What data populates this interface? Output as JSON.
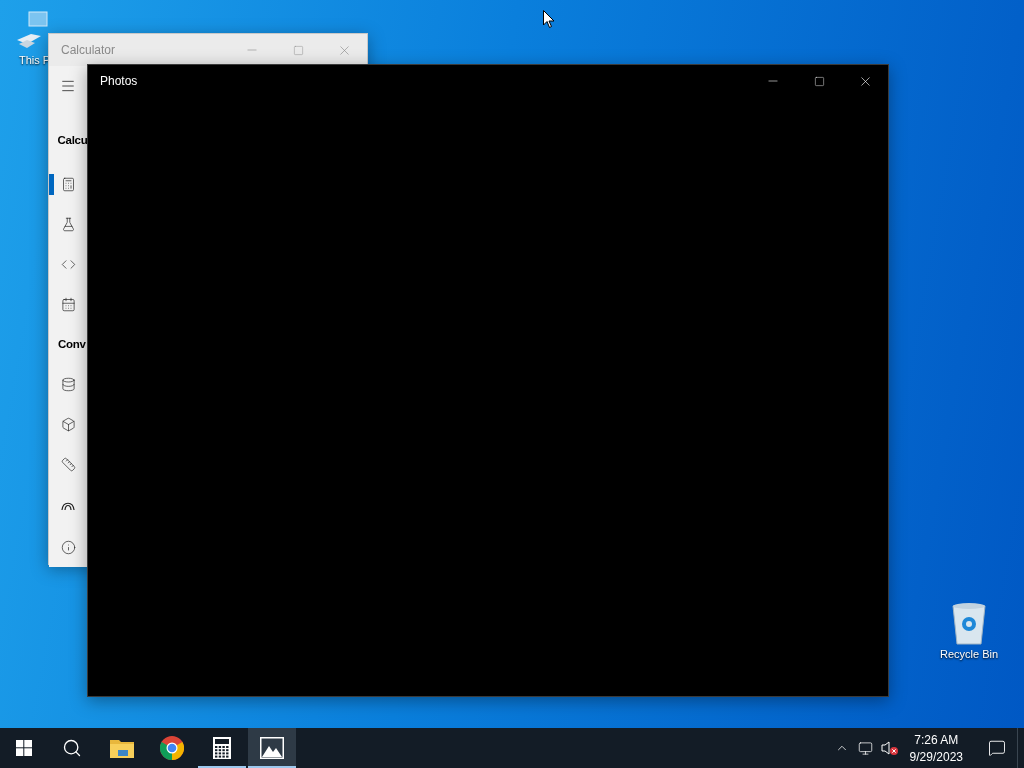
{
  "desktop_icons": [
    {
      "label": "This P"
    },
    {
      "label": "Recycle Bin"
    }
  ],
  "calculator_window": {
    "title": "Calculator",
    "active": false,
    "nav": [
      {
        "kind": "menu"
      },
      {
        "kind": "heading",
        "label": "Calcu"
      },
      {
        "kind": "mode",
        "selected": true
      },
      {
        "kind": "mode",
        "selected": false
      },
      {
        "kind": "mode",
        "selected": false
      },
      {
        "kind": "mode",
        "selected": false
      },
      {
        "kind": "heading",
        "label": "Conv"
      },
      {
        "kind": "mode",
        "selected": false
      },
      {
        "kind": "mode",
        "selected": false
      },
      {
        "kind": "mode",
        "selected": false
      },
      {
        "kind": "mode",
        "selected": false
      },
      {
        "kind": "about"
      }
    ]
  },
  "photos_window": {
    "title": "Photos",
    "active": true
  },
  "taskbar": {
    "apps": [
      {
        "running": false,
        "selected": false
      },
      {
        "running": false,
        "selected": false
      },
      {
        "running": true,
        "selected": false
      },
      {
        "running": true,
        "selected": true
      }
    ],
    "clock": {
      "time": "7:26 AM",
      "date": "9/29/2023"
    }
  }
}
